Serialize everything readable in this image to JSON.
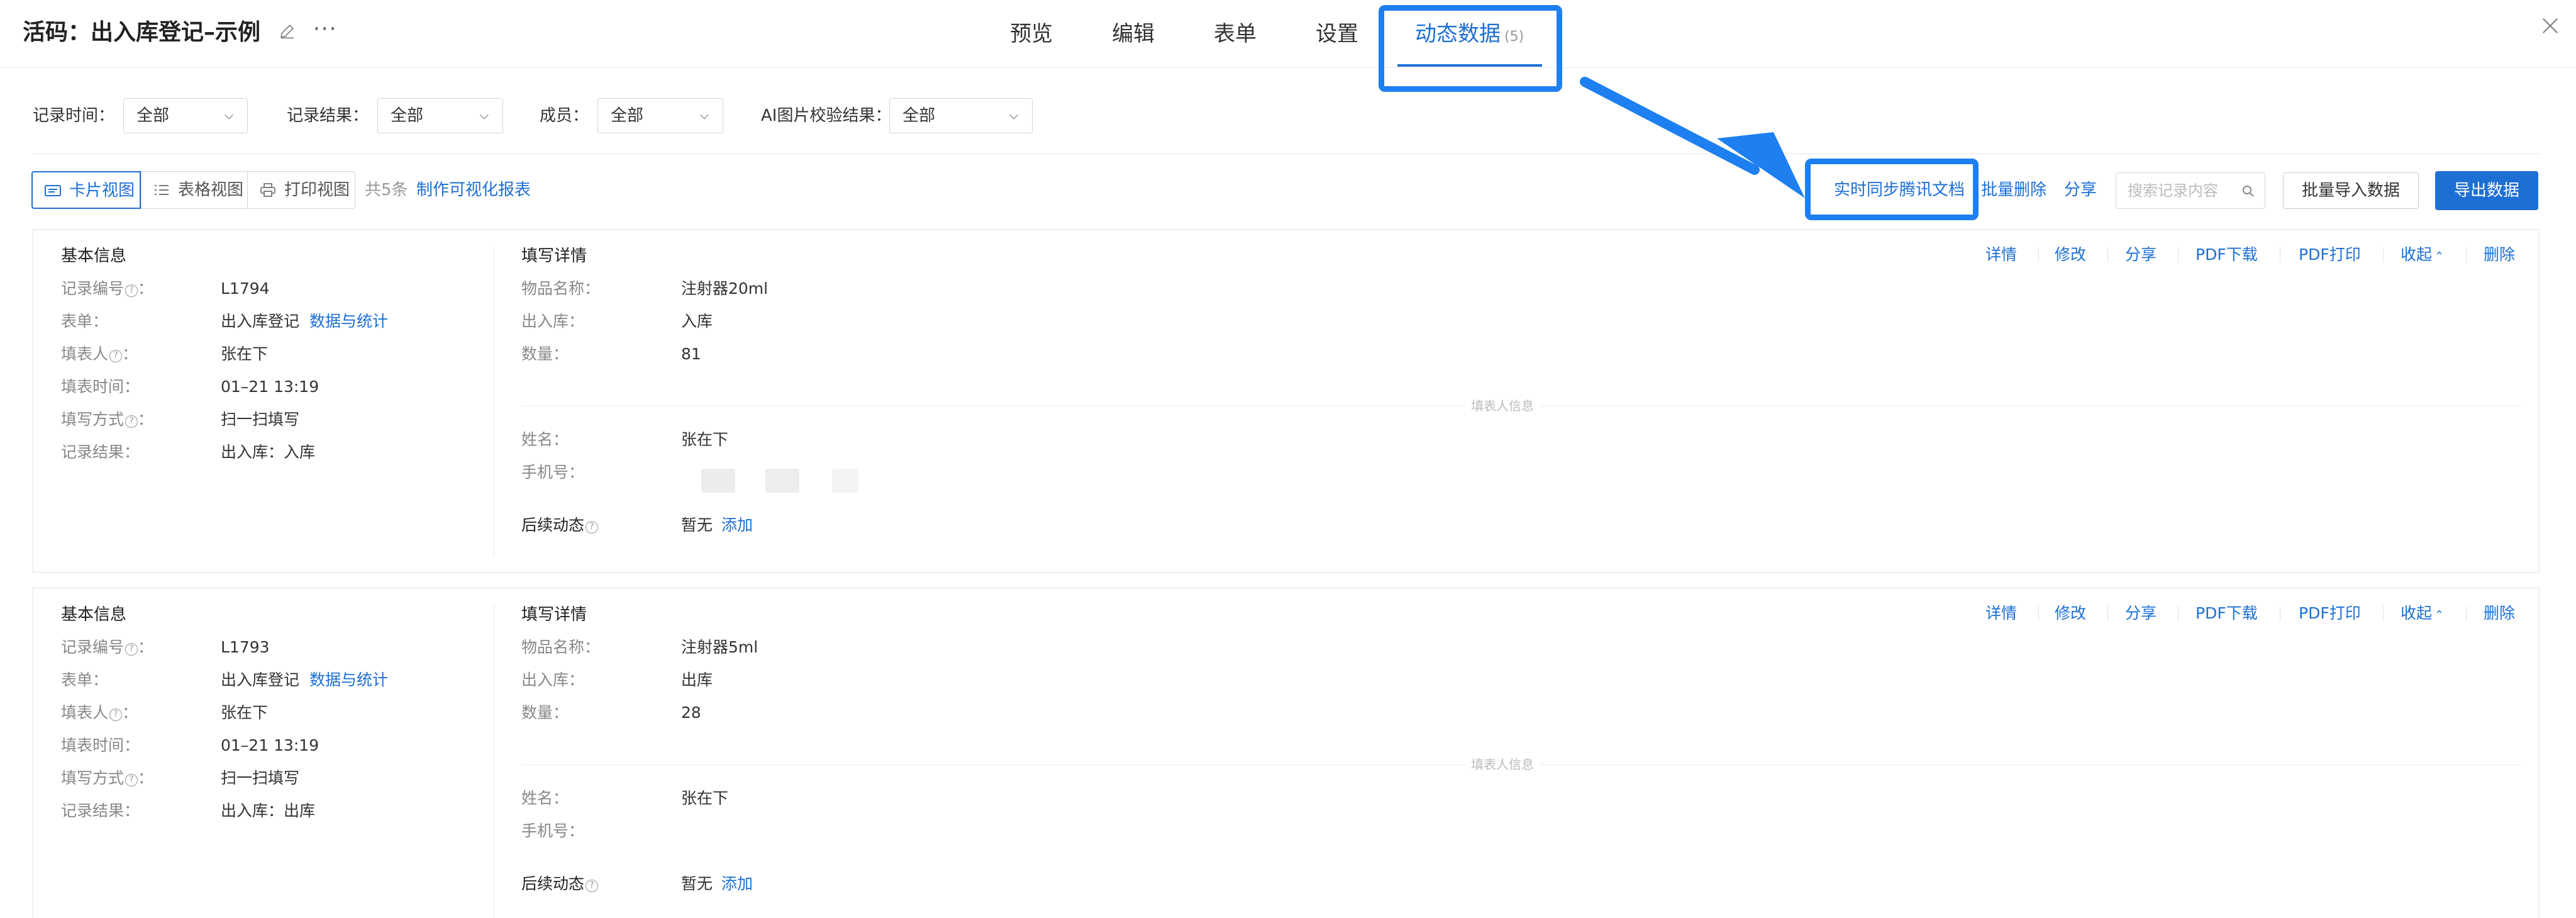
{
  "header": {
    "title": "活码：出入库登记–示例",
    "tabs": [
      {
        "label": "预览"
      },
      {
        "label": "编辑"
      },
      {
        "label": "表单"
      },
      {
        "label": "设置"
      },
      {
        "label": "动态数据",
        "count": "(5)"
      }
    ],
    "active_tab": "动态数据"
  },
  "filters": [
    {
      "label": "记录时间：",
      "value": "全部"
    },
    {
      "label": "记录结果：",
      "value": "全部"
    },
    {
      "label": "成员：",
      "value": "全部"
    },
    {
      "label": "AI图片校验结果：",
      "value": "全部"
    }
  ],
  "toolbar": {
    "views": [
      "卡片视图",
      "表格视图",
      "打印视图"
    ],
    "active_view": "卡片视图",
    "count_text": "共5条",
    "report_link": "制作可视化报表",
    "sync_link": "实时同步腾讯文档",
    "batch_delete": "批量删除",
    "share": "分享",
    "search_placeholder": "搜索记录内容",
    "import_button": "批量导入数据",
    "export_button": "导出数据"
  },
  "card_actions": [
    "详情",
    "修改",
    "分享",
    "PDF下载",
    "PDF打印",
    "收起",
    "删除"
  ],
  "records": [
    {
      "basic_title": "基本信息",
      "basic": [
        {
          "label": "记录编号",
          "value": "L1794",
          "help": true
        },
        {
          "label": "表单：",
          "value": "出入库登记",
          "link": "数据与统计"
        },
        {
          "label": "填表人",
          "value": "张在下",
          "help": true
        },
        {
          "label": "填表时间：",
          "value": "01–21 13:19"
        },
        {
          "label": "填写方式",
          "value": "扫一扫填写",
          "help": true
        },
        {
          "label": "记录结果：",
          "value": "出入库：入库"
        }
      ],
      "detail_title": "填写详情",
      "details": [
        {
          "label": "物品名称：",
          "value": "注射器20ml"
        },
        {
          "label": "出入库：",
          "value": "入库"
        },
        {
          "label": "数量：",
          "value": "81"
        }
      ],
      "submitter_title": "填表人信息",
      "submitter": [
        {
          "label": "姓名：",
          "value": "张在下"
        },
        {
          "label": "手机号：",
          "value": ""
        }
      ],
      "followup_label": "后续动态",
      "followup_value": "暂无",
      "followup_add": "添加"
    },
    {
      "basic_title": "基本信息",
      "basic": [
        {
          "label": "记录编号",
          "value": "L1793",
          "help": true
        },
        {
          "label": "表单：",
          "value": "出入库登记",
          "link": "数据与统计"
        },
        {
          "label": "填表人",
          "value": "张在下",
          "help": true
        },
        {
          "label": "填表时间：",
          "value": "01–21 13:19"
        },
        {
          "label": "填写方式",
          "value": "扫一扫填写",
          "help": true
        },
        {
          "label": "记录结果：",
          "value": "出入库：出库"
        }
      ],
      "detail_title": "填写详情",
      "details": [
        {
          "label": "物品名称：",
          "value": "注射器5ml"
        },
        {
          "label": "出入库：",
          "value": "出库"
        },
        {
          "label": "数量：",
          "value": "28"
        }
      ],
      "submitter_title": "填表人信息",
      "submitter": [
        {
          "label": "姓名：",
          "value": "张在下"
        },
        {
          "label": "手机号：",
          "value": ""
        }
      ],
      "followup_label": "后续动态",
      "followup_value": "暂无",
      "followup_add": "添加"
    }
  ],
  "colors": {
    "accent": "#1d6fd4",
    "highlight": "#1e7ff0"
  }
}
